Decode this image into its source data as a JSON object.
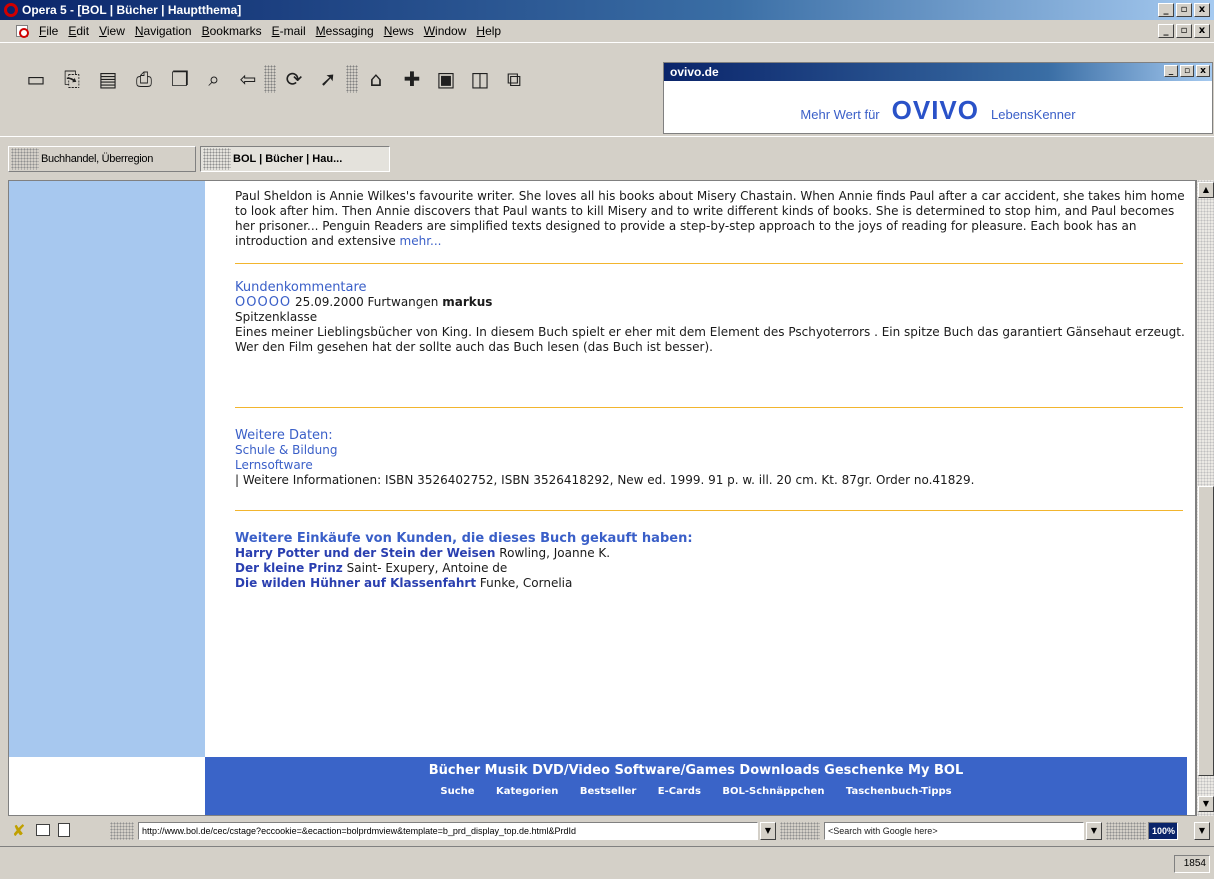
{
  "window": {
    "title": "Opera 5 - [BOL | Bücher | Hauptthema]",
    "buttons": [
      "_",
      "▫",
      "x"
    ]
  },
  "menu": {
    "items": [
      "File",
      "Edit",
      "View",
      "Navigation",
      "Bookmarks",
      "E-mail",
      "Messaging",
      "News",
      "Window",
      "Help"
    ]
  },
  "ad_panel": {
    "title": "ovivo.de",
    "tagline_left": "Mehr Wert für",
    "logo": "OVIVO",
    "tagline_right": "LebensKenner"
  },
  "tabs": [
    {
      "label": "Buchhandel, Überregion",
      "active": false
    },
    {
      "label": "BOL | Bücher | Hau...",
      "active": true
    }
  ],
  "page": {
    "description": "Paul Sheldon is Annie Wilkes's favourite writer. She loves all his books about Misery Chastain. When Annie finds Paul after a car accident, she takes him home to look after him. Then Annie discovers that Paul wants to kill Misery and to write different kinds of books. She is determined to stop him, and Paul becomes her prisoner... Penguin Readers are simplified texts designed to provide a step-by-step approach to the joys of reading for pleasure. Each book has an introduction and extensive",
    "more_link": "mehr...",
    "comments": {
      "title": "Kundenkommentare",
      "rating_circles": "OOOOO",
      "date_place": "25.09.2000 Furtwangen",
      "author": "markus",
      "headline": "Spitzenklasse",
      "body": "Eines meiner Lieblingsbücher von King. In diesem Buch spielt er eher mit dem Element des Pschyoterrors . Ein spitze Buch das garantiert Gänsehaut erzeugt. Wer den Film gesehen hat der sollte auch das Buch lesen (das Buch ist besser)."
    },
    "more_data": {
      "title": "Weitere Daten:",
      "links": [
        "Schule & Bildung",
        "Lernsoftware"
      ],
      "info": "| Weitere Informationen: ISBN 3526402752, ISBN 3526418292, New ed. 1999. 91 p. w. ill. 20 cm. Kt. 87gr. Order no.41829."
    },
    "also_bought": {
      "title": "Weitere Einkäufe von Kunden, die dieses Buch gekauft haben:",
      "items": [
        {
          "book": "Harry Potter und der Stein der Weisen",
          "author": "Rowling, Joanne K."
        },
        {
          "book": "Der kleine Prinz",
          "author": "Saint- Exupery, Antoine de"
        },
        {
          "book": "Die wilden Hühner auf Klassenfahrt",
          "author": "Funke, Cornelia"
        }
      ]
    },
    "footer": {
      "nav1": "Bücher Musik DVD/Video Software/Games Downloads Geschenke My BOL",
      "nav2": [
        "Suche",
        "Kategorien",
        "Bestseller",
        "E-Cards",
        "BOL-Schnäppchen",
        "Taschenbuch-Tipps"
      ]
    }
  },
  "addressbar": {
    "url": "http://www.bol.de/cec/cstage?eccookie=&ecaction=bolprdmview&template=b_prd_display_top.de.html&PrdId",
    "search_placeholder": "<Search with Google here>",
    "zoom": "100%"
  },
  "status": {
    "counter": "1854"
  }
}
